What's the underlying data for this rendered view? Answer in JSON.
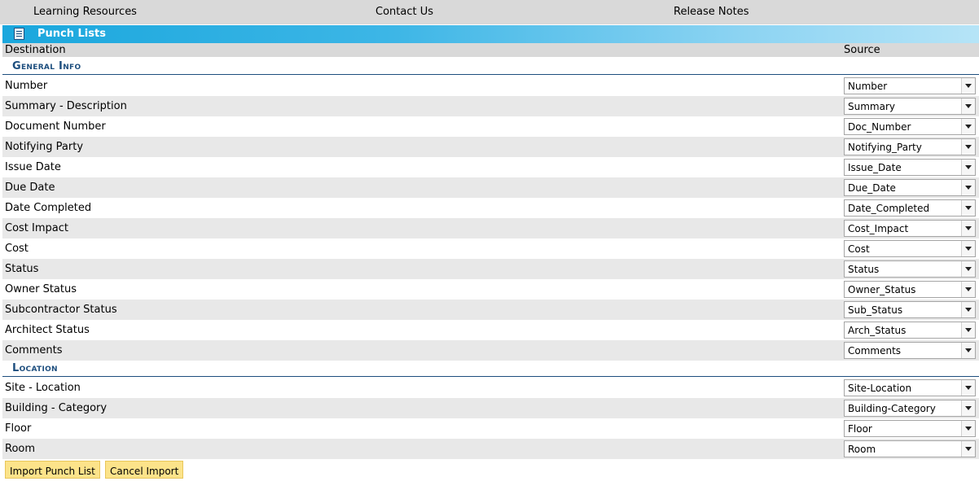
{
  "nav": {
    "learning": "Learning Resources",
    "contact": "Contact Us",
    "release": "Release Notes"
  },
  "title": "Punch Lists",
  "columns": {
    "destination": "Destination",
    "source": "Source"
  },
  "sections": {
    "general": "General Info",
    "location": "Location"
  },
  "general_rows": [
    {
      "label": "Number",
      "value": "Number"
    },
    {
      "label": "Summary - Description",
      "value": "Summary"
    },
    {
      "label": "Document Number",
      "value": "Doc_Number"
    },
    {
      "label": "Notifying Party",
      "value": "Notifying_Party"
    },
    {
      "label": "Issue Date",
      "value": "Issue_Date"
    },
    {
      "label": "Due Date",
      "value": "Due_Date"
    },
    {
      "label": "Date Completed",
      "value": "Date_Completed"
    },
    {
      "label": "Cost Impact",
      "value": "Cost_Impact"
    },
    {
      "label": "Cost",
      "value": "Cost"
    },
    {
      "label": "Status",
      "value": "Status"
    },
    {
      "label": "Owner Status",
      "value": "Owner_Status"
    },
    {
      "label": "Subcontractor Status",
      "value": "Sub_Status"
    },
    {
      "label": "Architect Status",
      "value": "Arch_Status"
    },
    {
      "label": "Comments",
      "value": "Comments"
    }
  ],
  "location_rows": [
    {
      "label": "Site - Location",
      "value": "Site-Location"
    },
    {
      "label": "Building - Category",
      "value": "Building-Category"
    },
    {
      "label": "Floor",
      "value": "Floor"
    },
    {
      "label": "Room",
      "value": "Room"
    }
  ],
  "buttons": {
    "import": "Import Punch List",
    "cancel": "Cancel Import"
  },
  "colors": {
    "accent": "#1aa7dd",
    "section_text": "#1d4e7e",
    "button_bg": "#fce38a"
  }
}
